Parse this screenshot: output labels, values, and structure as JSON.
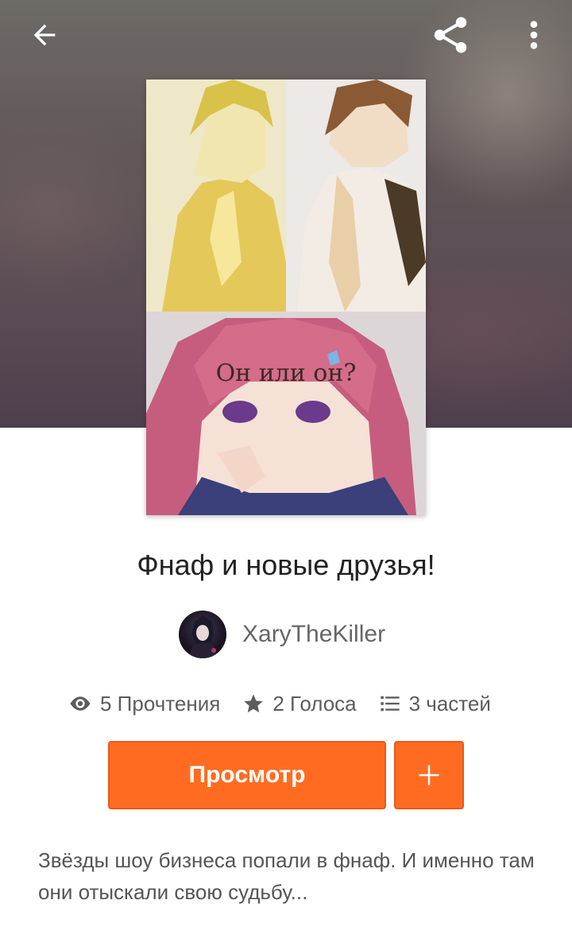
{
  "header": {
    "back_icon": "arrow-left-icon",
    "share_icon": "share-icon",
    "more_icon": "more-vertical-icon"
  },
  "cover": {
    "caption": "Он или он?"
  },
  "story": {
    "title": "Фнаф и новые друзья!",
    "author": "XaryTheKiller"
  },
  "stats": {
    "reads": "5 Прочтения",
    "votes": "2 Голоса",
    "parts": "3 частей"
  },
  "actions": {
    "read_label": "Просмотр",
    "add_label": "+"
  },
  "description": "Звёзды шоу бизнеса попали в фнаф. И именно там они отыскали свою судьбу...",
  "colors": {
    "accent": "#ff6c21",
    "text_primary": "#222222",
    "text_secondary": "#5c5c5c"
  }
}
